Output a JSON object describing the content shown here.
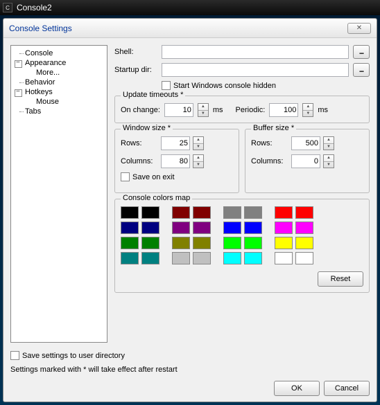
{
  "app_title": "Console2",
  "dialog_title": "Console Settings",
  "tree": {
    "console": "Console",
    "appearance": "Appearance",
    "more": "More...",
    "behavior": "Behavior",
    "hotkeys": "Hotkeys",
    "mouse": "Mouse",
    "tabs": "Tabs"
  },
  "fields": {
    "shell_label": "Shell:",
    "shell_value": "",
    "startup_label": "Startup dir:",
    "startup_value": "",
    "browse": "...",
    "hidden_chk": "Start Windows console hidden"
  },
  "timeouts": {
    "group": "Update timeouts *",
    "on_change": "On change:",
    "on_change_value": "10",
    "periodic": "Periodic:",
    "periodic_value": "100",
    "ms": "ms"
  },
  "window_size": {
    "group": "Window size *",
    "rows": "Rows:",
    "rows_value": "25",
    "cols": "Columns:",
    "cols_value": "80",
    "save_exit": "Save on exit"
  },
  "buffer_size": {
    "group": "Buffer size *",
    "rows": "Rows:",
    "rows_value": "500",
    "cols": "Columns:",
    "cols_value": "0"
  },
  "colors": {
    "group": "Console colors map",
    "reset": "Reset",
    "pairs": [
      [
        "#000000",
        "#000000",
        "#800000",
        "#800000",
        "#808080",
        "#808080",
        "#ff0000",
        "#ff0000"
      ],
      [
        "#000080",
        "#000080",
        "#800080",
        "#800080",
        "#0000ff",
        "#0000ff",
        "#ff00ff",
        "#ff00ff"
      ],
      [
        "#008000",
        "#008000",
        "#808000",
        "#808000",
        "#00ff00",
        "#00ff00",
        "#ffff00",
        "#ffff00"
      ],
      [
        "#008080",
        "#008080",
        "#c0c0c0",
        "#c0c0c0",
        "#00ffff",
        "#00ffff",
        "#ffffff",
        "#ffffff"
      ]
    ]
  },
  "footer": {
    "save_user_dir": "Save settings to user directory",
    "note": "Settings marked with * will take effect after restart",
    "ok": "OK",
    "cancel": "Cancel"
  }
}
